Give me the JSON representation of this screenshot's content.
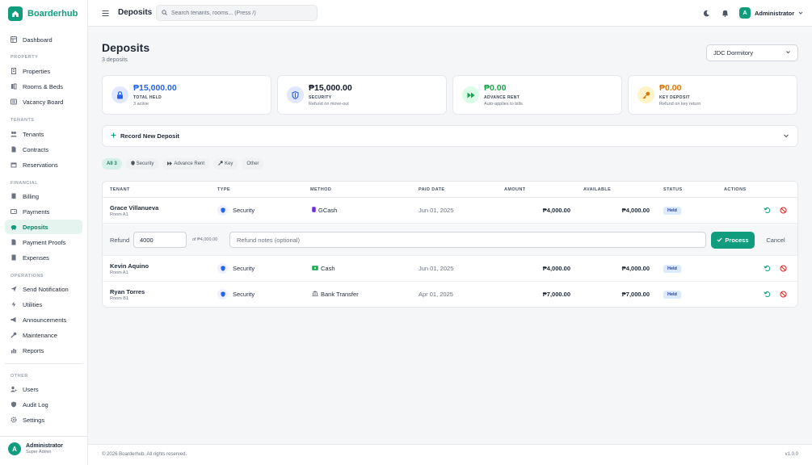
{
  "app": {
    "name": "Boarderhub"
  },
  "sidebar": {
    "items": [
      {
        "label": "Dashboard",
        "icon": "dashboard-icon"
      },
      {
        "section": "PROPERTY"
      },
      {
        "label": "Properties",
        "icon": "building-icon"
      },
      {
        "label": "Rooms & Beds",
        "icon": "bed-icon"
      },
      {
        "label": "Vacancy Board",
        "icon": "board-icon"
      },
      {
        "section": "TENANTS"
      },
      {
        "label": "Tenants",
        "icon": "users-icon"
      },
      {
        "label": "Contracts",
        "icon": "document-icon"
      },
      {
        "label": "Reservations",
        "icon": "calendar-icon"
      },
      {
        "section": "FINANCIAL"
      },
      {
        "label": "Billing",
        "icon": "receipt-icon"
      },
      {
        "label": "Payments",
        "icon": "wallet-icon"
      },
      {
        "label": "Deposits",
        "icon": "piggy-bank-icon",
        "active": true
      },
      {
        "label": "Payment Proofs",
        "icon": "file-icon"
      },
      {
        "label": "Expenses",
        "icon": "expense-icon"
      },
      {
        "section": "OPERATIONS"
      },
      {
        "label": "Send Notification",
        "icon": "send-icon"
      },
      {
        "label": "Utilities",
        "icon": "bolt-icon"
      },
      {
        "label": "Announcements",
        "icon": "megaphone-icon"
      },
      {
        "label": "Maintenance",
        "icon": "wrench-icon"
      },
      {
        "label": "Reports",
        "icon": "chart-icon"
      },
      {
        "section": "OTHER"
      },
      {
        "label": "Users",
        "icon": "user-cog-icon"
      },
      {
        "label": "Audit Log",
        "icon": "shield-icon"
      },
      {
        "label": "Settings",
        "icon": "gear-icon"
      }
    ],
    "user": {
      "initial": "A",
      "name": "Administrator",
      "role": "Super Admin"
    }
  },
  "topbar": {
    "title": "Deposits",
    "search_placeholder": "Search tenants, rooms... (Press /)",
    "user_initial": "A",
    "user_name": "Administrator"
  },
  "page": {
    "title": "Deposits",
    "subtitle": "3 deposits",
    "property_selected": "JDC Dormitory"
  },
  "cards": [
    {
      "value": "₱15,000.00",
      "label": "TOTAL HELD",
      "note": "3 active",
      "color": "#2563eb",
      "bg": "#e0e7ff",
      "icon": "lock-icon"
    },
    {
      "value": "₱15,000.00",
      "label": "SECURITY",
      "note": "Refund on move-out",
      "color": "#111827",
      "bg": "#e0e7ff",
      "icon": "shield-icon"
    },
    {
      "value": "₱0.00",
      "label": "ADVANCE RENT",
      "note": "Auto-applies to bills",
      "color": "#16a34a",
      "bg": "#dcfce7",
      "icon": "fast-forward-icon"
    },
    {
      "value": "₱0.00",
      "label": "KEY DEPOSIT",
      "note": "Refund on key return",
      "color": "#d97706",
      "bg": "#fef3c7",
      "icon": "key-icon"
    }
  ],
  "record": {
    "label": "Record New Deposit"
  },
  "filters": [
    {
      "label": "All 3",
      "active": true
    },
    {
      "label": "Security",
      "icon": "shield-icon"
    },
    {
      "label": "Advance Rent",
      "icon": "fast-forward-icon"
    },
    {
      "label": "Key",
      "icon": "key-icon"
    },
    {
      "label": "Other"
    }
  ],
  "table": {
    "headers": [
      "TENANT",
      "TYPE",
      "METHOD",
      "PAID DATE",
      "AMOUNT",
      "AVAILABLE",
      "STATUS",
      "ACTIONS"
    ],
    "rows": [
      {
        "tenant": "Grace Villanueva",
        "room": "Room A1",
        "type": "Security",
        "method": "GCash",
        "method_icon": "phone-icon",
        "paid": "Jun 01, 2025",
        "amount": "₱4,000.00",
        "available": "₱4,000.00",
        "status": "Held"
      },
      {
        "tenant": "Kevin Aquino",
        "room": "Room A1",
        "type": "Security",
        "method": "Cash",
        "method_icon": "cash-icon",
        "paid": "Jun 01, 2025",
        "amount": "₱4,000.00",
        "available": "₱4,000.00",
        "status": "Held"
      },
      {
        "tenant": "Ryan Torres",
        "room": "Room B1",
        "type": "Security",
        "method": "Bank Transfer",
        "method_icon": "bank-icon",
        "paid": "Apr 01, 2025",
        "amount": "₱7,000.00",
        "available": "₱7,000.00",
        "status": "Held"
      }
    ],
    "refund": {
      "label": "Refund",
      "amount": "4000",
      "of_text": "of ₱4,000.00",
      "notes_placeholder": "Refund notes (optional)",
      "process_label": "Process",
      "cancel_label": "Cancel"
    }
  },
  "footer": {
    "copyright": "© 2026 Boarderhub. All rights reserved.",
    "version": "v1.0.0"
  },
  "colors": {
    "brand": "#0f9d7d",
    "refund_action": "#0f9d7d",
    "forfeit_action": "#dc2626"
  }
}
